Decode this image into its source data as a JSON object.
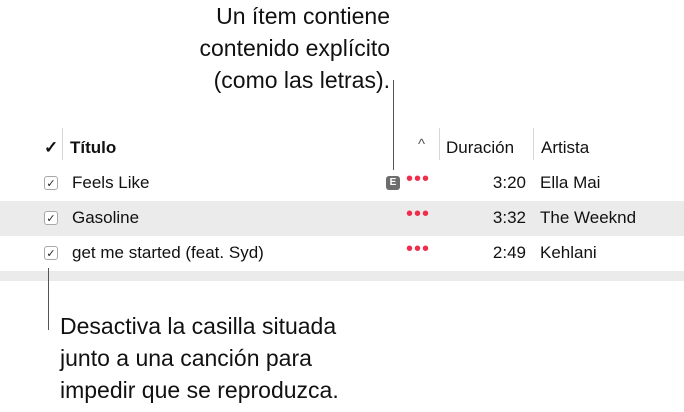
{
  "callout_top": [
    "Un ítem contiene",
    "contenido explícito",
    "(como las letras)."
  ],
  "header": {
    "check_glyph": "✓",
    "title": "Título",
    "sort_glyph": "^",
    "duration": "Duración",
    "artist": "Artista"
  },
  "rows": [
    {
      "title": "Feels Like",
      "explicit": "E",
      "dots": "•••",
      "duration": "3:20",
      "artist": "Ella Mai",
      "checked": "✓"
    },
    {
      "title": "Gasoline",
      "explicit": "",
      "dots": "•••",
      "duration": "3:32",
      "artist": "The Weeknd",
      "checked": "✓"
    },
    {
      "title": "get me started (feat. Syd)",
      "explicit": "",
      "dots": "•••",
      "duration": "2:49",
      "artist": "Kehlani",
      "checked": "✓"
    }
  ],
  "callout_bottom": [
    "Desactiva la casilla situada",
    "junto a una canción para",
    "impedir que se reproduzca."
  ],
  "colors": {
    "dots": "#f02d4a",
    "alt_row": "#ebebeb",
    "explicit_badge": "#6d6d6d"
  }
}
